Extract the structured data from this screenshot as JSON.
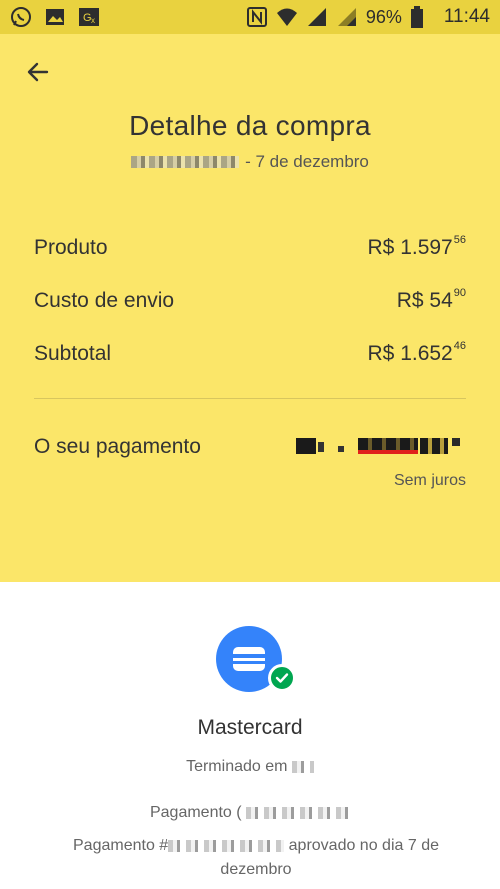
{
  "status_bar": {
    "battery": "96%",
    "time": "11:44",
    "icons_left": [
      "whatsapp-icon",
      "gallery-icon",
      "translate-icon"
    ],
    "icons_right": [
      "nfc-icon",
      "wifi-icon",
      "signal-icon",
      "signal-icon-2",
      "battery-icon"
    ]
  },
  "header": {
    "title": "Detalhe da compra",
    "date": "- 7 de dezembro"
  },
  "summary": {
    "items": [
      {
        "label": "Produto",
        "currency": "R$",
        "integer": "1.597",
        "cents": "56"
      },
      {
        "label": "Custo de envio",
        "currency": "R$",
        "integer": "54",
        "cents": "90"
      },
      {
        "label": "Subtotal",
        "currency": "R$",
        "integer": "1.652",
        "cents": "46"
      }
    ],
    "payment_label": "O seu pagamento",
    "payment_note": "Sem juros"
  },
  "payment_method": {
    "name": "Mastercard",
    "ending_label": "Terminado em",
    "payment_prefix": "Pagamento (",
    "status_prefix": "Pagamento #",
    "status_text": "aprovado no dia 7 de dezembro"
  },
  "colors": {
    "accent_yellow": "#fbe669",
    "status_yellow": "#e9d23f",
    "card_blue": "#3483fa",
    "check_green": "#00a650"
  }
}
